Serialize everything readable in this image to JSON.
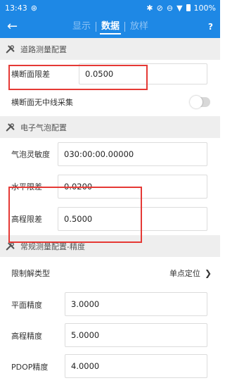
{
  "status_bar": {
    "time": "13:43",
    "battery": "100%"
  },
  "toolbar": {
    "tabs": [
      {
        "label": "显示",
        "active": false
      },
      {
        "label": "数据",
        "active": true
      },
      {
        "label": "放样",
        "active": false
      }
    ],
    "help_label": "?"
  },
  "sections": {
    "road": {
      "title": "道路测量配置",
      "cross_section_limit": {
        "label": "横断面限差",
        "value": "0.0500"
      },
      "no_centerline": {
        "label": "横断面无中线采集",
        "enabled": false
      }
    },
    "bubble": {
      "title": "电子气泡配置",
      "sensitivity": {
        "label": "气泡灵敏度",
        "value": "030:00:00.00000"
      },
      "horizontal_limit": {
        "label": "水平限差",
        "value": "0.0200"
      },
      "elevation_limit": {
        "label": "高程限差",
        "value": "0.5000"
      }
    },
    "precision": {
      "title": "常规测量配置-精度",
      "solution_type": {
        "label": "限制解类型",
        "value": "单点定位"
      },
      "plane_precision": {
        "label": "平面精度",
        "value": "3.0000"
      },
      "elevation_precision": {
        "label": "高程精度",
        "value": "5.0000"
      },
      "pdop_precision": {
        "label": "PDOP精度",
        "value": "4.0000"
      }
    }
  },
  "colors": {
    "primary": "#1e88e5",
    "highlight": "#e53935",
    "section_bg": "#eeeeee"
  }
}
